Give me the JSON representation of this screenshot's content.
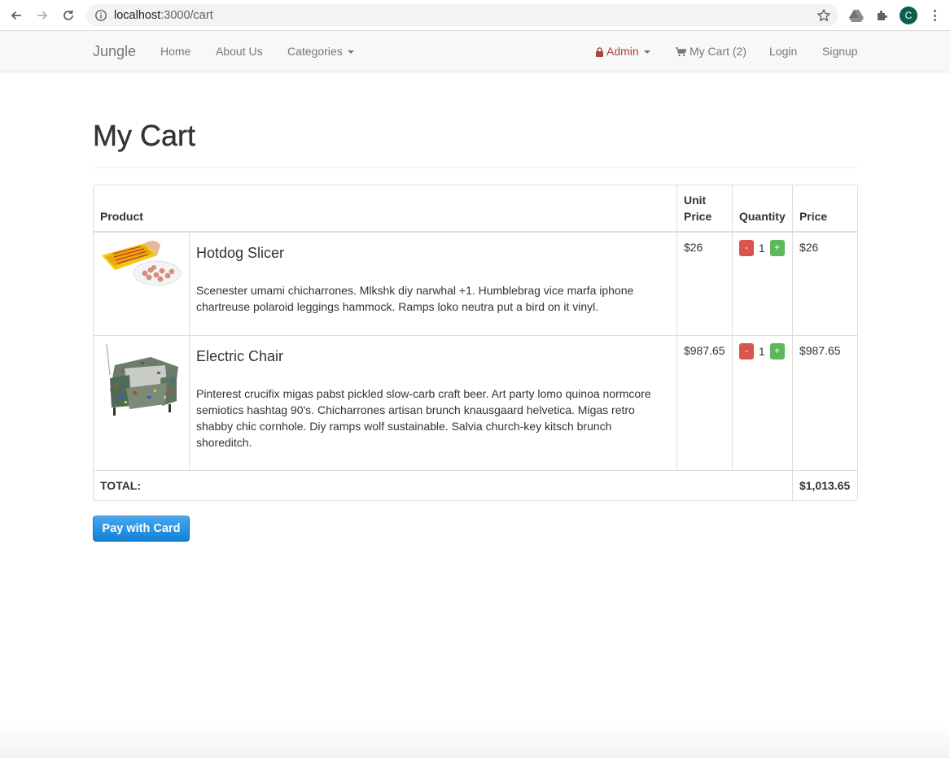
{
  "browser": {
    "url_host": "localhost",
    "url_path": ":3000/cart",
    "avatar_letter": "C"
  },
  "navbar": {
    "brand": "Jungle",
    "links": {
      "home": "Home",
      "about": "About Us",
      "categories": "Categories",
      "admin": "Admin",
      "cart": "My Cart (2)",
      "login": "Login",
      "signup": "Signup"
    }
  },
  "page": {
    "title": "My Cart"
  },
  "table": {
    "headers": {
      "product": "Product",
      "unit_price": "Unit Price",
      "quantity": "Quantity",
      "price": "Price"
    },
    "items": [
      {
        "name": "Hotdog Slicer",
        "description": "Scenester umami chicharrones. Mlkshk diy narwhal +1. Humblebrag vice marfa iphone chartreuse polaroid leggings hammock. Ramps loko neutra put a bird on it vinyl.",
        "unit_price": "$26",
        "quantity": "1",
        "price": "$26",
        "image": "hotdog-slicer-image"
      },
      {
        "name": "Electric Chair",
        "description": "Pinterest crucifix migas pabst pickled slow-carb craft beer. Art party lomo quinoa normcore semiotics hashtag 90's. Chicharrones artisan brunch knausgaard helvetica. Migas retro shabby chic cornhole. Diy ramps wolf sustainable. Salvia church-key kitsch brunch shoreditch.",
        "unit_price": "$987.65",
        "quantity": "1",
        "price": "$987.65",
        "image": "electric-chair-image"
      }
    ],
    "qty_minus": "-",
    "qty_plus": "+",
    "total_label": "TOTAL:",
    "total_value": "$1,013.65"
  },
  "actions": {
    "pay": "Pay with Card"
  },
  "colors": {
    "admin_link": "#a94442",
    "minus_button": "#d9534f",
    "plus_button": "#5cb85c",
    "pay_button": "#1a8ae0"
  }
}
